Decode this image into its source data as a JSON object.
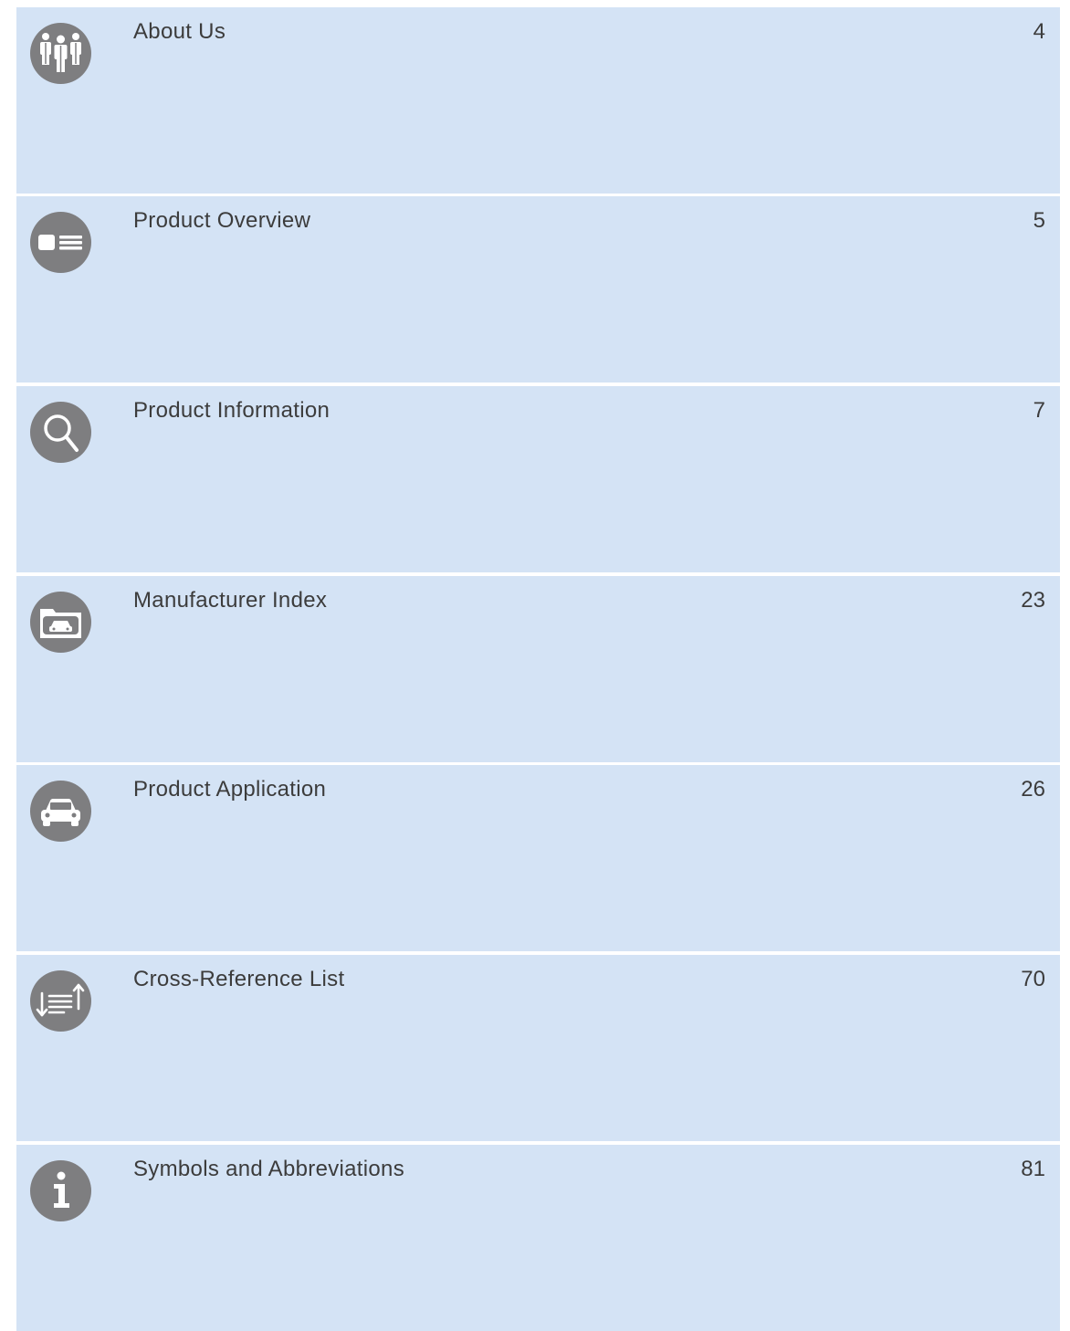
{
  "toc": {
    "entries": [
      {
        "title": "About Us",
        "page": "4",
        "icon": "people-group-icon"
      },
      {
        "title": "Product Overview",
        "page": "5",
        "icon": "card-list-icon"
      },
      {
        "title": "Product Information",
        "page": "7",
        "icon": "magnifier-icon"
      },
      {
        "title": "Manufacturer Index",
        "page": "23",
        "icon": "folder-car-icon"
      },
      {
        "title": "Product Application",
        "page": "26",
        "icon": "car-icon"
      },
      {
        "title": "Cross-Reference List",
        "page": "70",
        "icon": "sort-arrows-icon"
      },
      {
        "title": "Symbols and Abbreviations",
        "page": "81",
        "icon": "info-icon"
      }
    ],
    "colors": {
      "row_background": "#d4e3f5",
      "icon_circle": "#7e7e80",
      "text": "#3c3c3c"
    }
  }
}
